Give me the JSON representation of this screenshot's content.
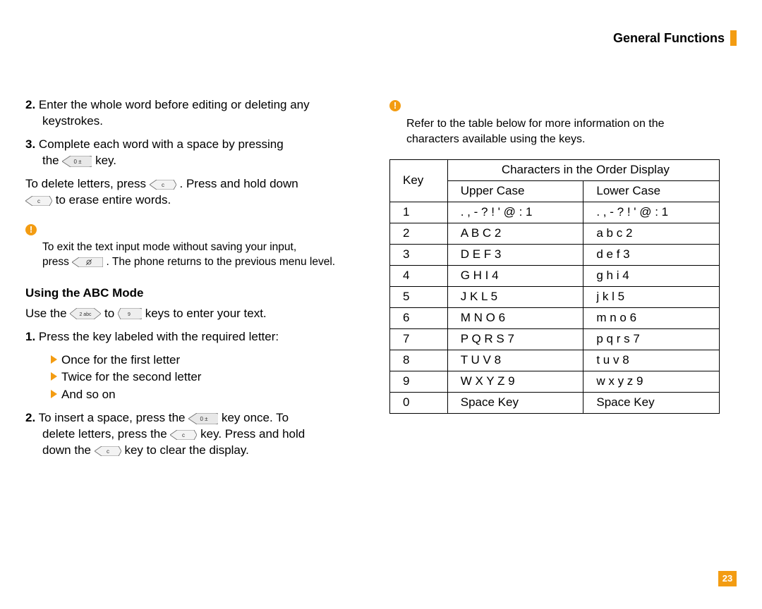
{
  "header": {
    "title": "General Functions"
  },
  "left": {
    "item2": {
      "n": "2.",
      "text_a": "Enter the whole word before editing or deleting any",
      "text_b": "keystrokes."
    },
    "item3": {
      "n": "3.",
      "text_a": "Complete each word with a space by pressing",
      "text_b": "the ",
      "text_c": " key."
    },
    "delete": {
      "a": "To delete letters, press ",
      "b": ". Press and hold down",
      "c": " to erase entire words."
    },
    "note1": {
      "icon": "!",
      "line1": "To exit the text input mode without saving your input,",
      "line2": "press ",
      "line3": ". The phone returns to the previous menu level."
    },
    "abc_head": "Using the ABC Mode",
    "use": {
      "a": "Use the ",
      "b": " to ",
      "c": " keys to enter your text."
    },
    "step1": {
      "n": "1.",
      "text": "Press the key labeled with the required letter:"
    },
    "bullets": {
      "a": "Once for the first letter",
      "b": "Twice for the second letter",
      "c": "And so on"
    },
    "step2": {
      "n": "2.",
      "a": "To insert a space, press the ",
      "b": " key once. To",
      "c": "delete letters, press the ",
      "d": " key. Press and hold",
      "e": "down the ",
      "f": " key to clear the display."
    }
  },
  "right": {
    "note_icon": "!",
    "note": {
      "a": "Refer to the table below for more information on the",
      "b": "characters available using the keys."
    },
    "table": {
      "head_key": "Key",
      "head_span": "Characters in the Order Display",
      "head_upper": "Upper Case",
      "head_lower": "Lower Case"
    }
  },
  "chart_data": {
    "type": "table",
    "title": "Characters in the Order Display",
    "columns": [
      "Key",
      "Upper Case",
      "Lower Case"
    ],
    "rows": [
      {
        "key": "1",
        "upper": ". , - ? ! ' @ : 1",
        "lower": ". , - ? ! ' @ : 1"
      },
      {
        "key": "2",
        "upper": "A B C 2",
        "lower": "a b c 2"
      },
      {
        "key": "3",
        "upper": "D E F 3",
        "lower": "d e f 3"
      },
      {
        "key": "4",
        "upper": "G H I 4",
        "lower": "g h i 4"
      },
      {
        "key": "5",
        "upper": "J K L 5",
        "lower": "j k l 5"
      },
      {
        "key": "6",
        "upper": "M N O 6",
        "lower": "m n o 6"
      },
      {
        "key": "7",
        "upper": "P Q R S 7",
        "lower": "p q r s 7"
      },
      {
        "key": "8",
        "upper": "T U V 8",
        "lower": "t u v 8"
      },
      {
        "key": "9",
        "upper": "W X Y Z 9",
        "lower": "w x y z 9"
      },
      {
        "key": "0",
        "upper": "Space Key",
        "lower": "Space Key"
      }
    ]
  },
  "keys": {
    "zero": {
      "name": "key-0-icon",
      "label": "0"
    },
    "clear": {
      "name": "key-clear-icon",
      "label": "c"
    },
    "end": {
      "name": "key-end-icon",
      "label": ""
    },
    "two": {
      "name": "key-2-icon",
      "label": "2"
    },
    "nine": {
      "name": "key-9-icon",
      "label": "9"
    }
  },
  "page_number": "23"
}
